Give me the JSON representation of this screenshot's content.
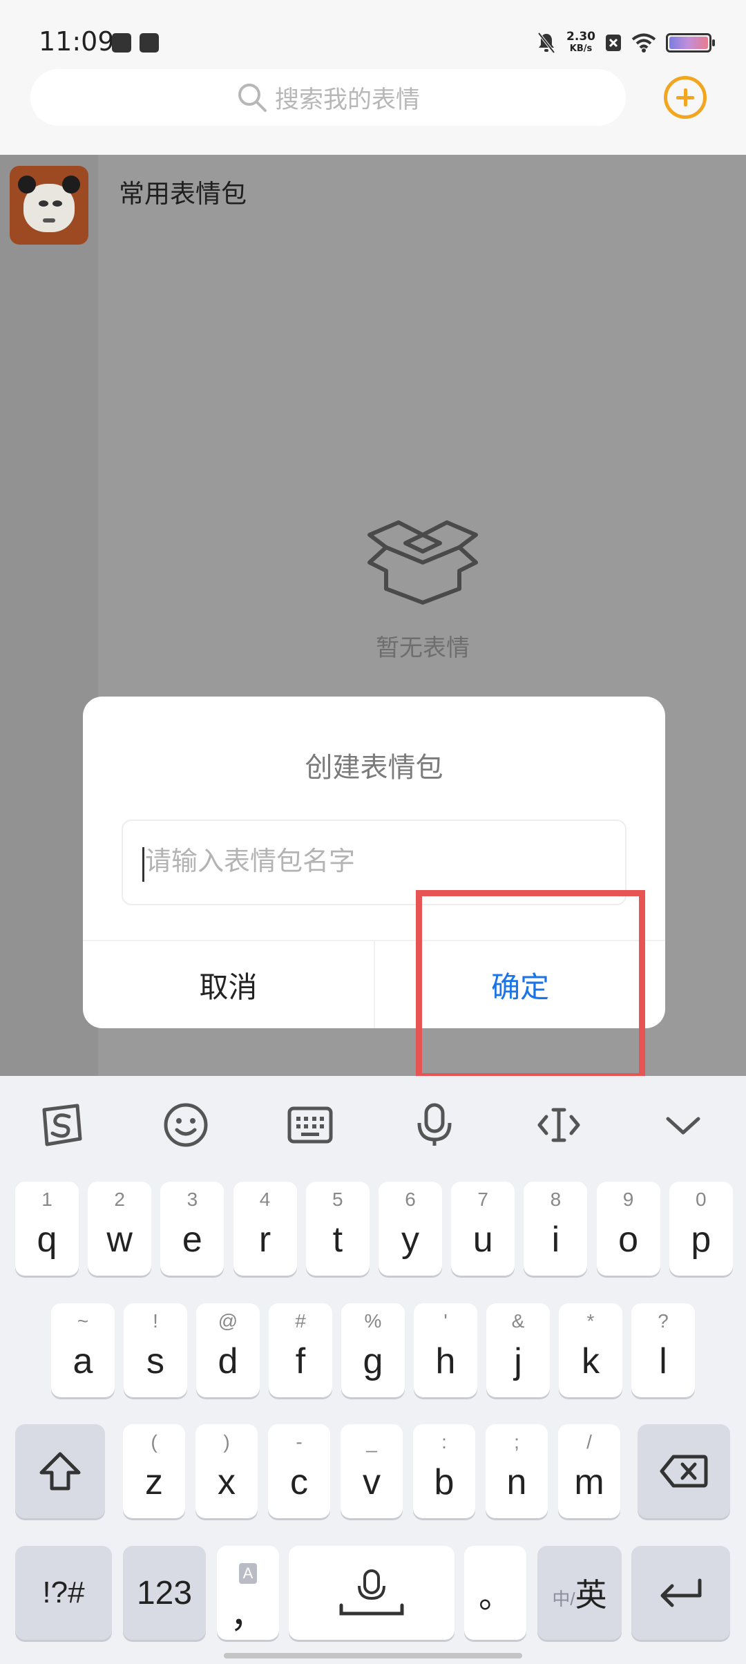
{
  "status_bar": {
    "time": "11:09",
    "net_speed_value": "2.30",
    "net_speed_unit": "KB/s",
    "battery_level": 0.85
  },
  "header": {
    "search_placeholder": "搜索我的表情",
    "add_icon": "plus-circle-icon",
    "accent_color": "#f2a51f"
  },
  "sidebar": {
    "pack_thumbnail_icon": "panda-meme-icon"
  },
  "main": {
    "pack_name": "常用表情包",
    "empty_text": "暂无表情",
    "empty_icon": "open-box-icon"
  },
  "dialog": {
    "title": "创建表情包",
    "input_placeholder": "请输入表情包名字",
    "cancel_label": "取消",
    "confirm_label": "确定",
    "confirm_color": "#1a73e8"
  },
  "highlight": {
    "color": "#e65454"
  },
  "keyboard": {
    "toolbar_icons": [
      "sogou-logo-icon",
      "emoji-icon",
      "keyboard-icon",
      "microphone-icon",
      "text-cursor-icon",
      "chevron-down-icon"
    ],
    "row1": [
      {
        "hint": "1",
        "key": "q"
      },
      {
        "hint": "2",
        "key": "w"
      },
      {
        "hint": "3",
        "key": "e"
      },
      {
        "hint": "4",
        "key": "r"
      },
      {
        "hint": "5",
        "key": "t"
      },
      {
        "hint": "6",
        "key": "y"
      },
      {
        "hint": "7",
        "key": "u"
      },
      {
        "hint": "8",
        "key": "i"
      },
      {
        "hint": "9",
        "key": "o"
      },
      {
        "hint": "0",
        "key": "p"
      }
    ],
    "row2": [
      {
        "hint": "~",
        "key": "a"
      },
      {
        "hint": "!",
        "key": "s"
      },
      {
        "hint": "@",
        "key": "d"
      },
      {
        "hint": "#",
        "key": "f"
      },
      {
        "hint": "%",
        "key": "g"
      },
      {
        "hint": "'",
        "key": "h"
      },
      {
        "hint": "&",
        "key": "j"
      },
      {
        "hint": "*",
        "key": "k"
      },
      {
        "hint": "?",
        "key": "l"
      }
    ],
    "row3": [
      {
        "hint": "(",
        "key": "z"
      },
      {
        "hint": ")",
        "key": "x"
      },
      {
        "hint": "-",
        "key": "c"
      },
      {
        "hint": "_",
        "key": "v"
      },
      {
        "hint": ":",
        "key": "b"
      },
      {
        "hint": ";",
        "key": "n"
      },
      {
        "hint": "/",
        "key": "m"
      }
    ],
    "symbols_label": "!?#",
    "numbers_label": "123",
    "comma_label": "，",
    "comma_hint": "A",
    "period_label": "。",
    "lang_small": "中/",
    "lang_big": "英",
    "shift_icon": "shift-icon",
    "backspace_icon": "backspace-icon",
    "space_icon": "space-mic-icon",
    "enter_icon": "enter-icon"
  }
}
